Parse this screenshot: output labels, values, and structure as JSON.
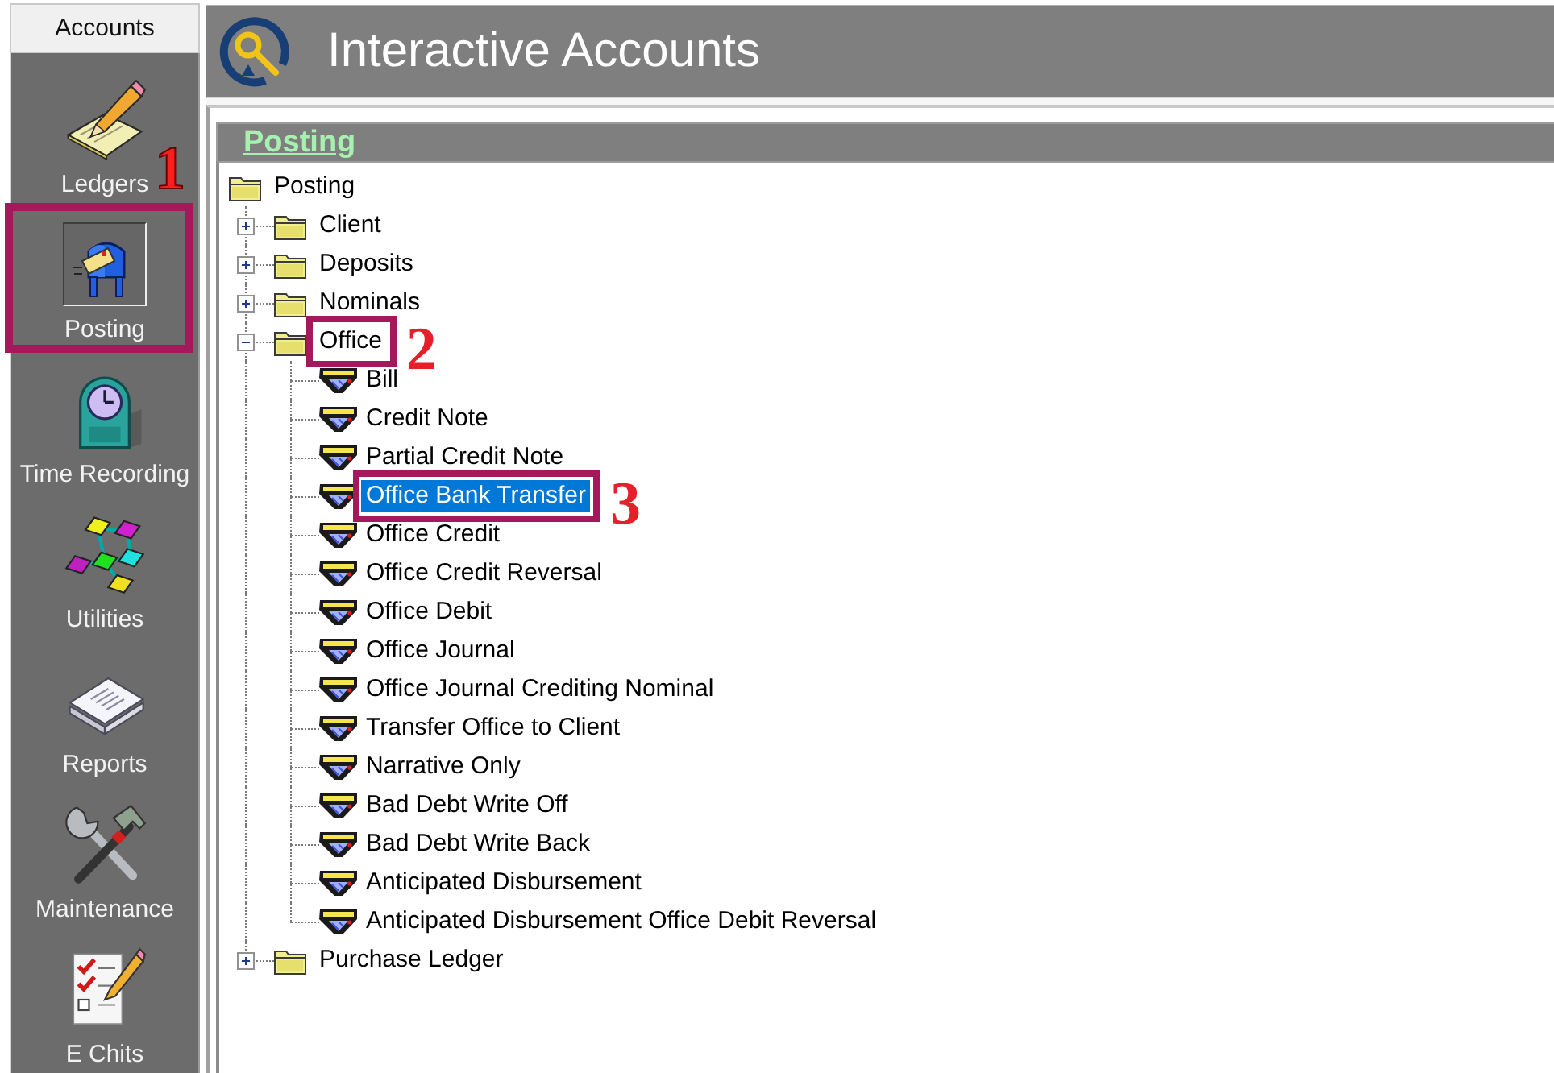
{
  "sidebar": {
    "header": "Accounts",
    "items": [
      {
        "label": "Ledgers",
        "kind": "ledgers",
        "selected": false
      },
      {
        "label": "Posting",
        "kind": "posting",
        "selected": true,
        "callout": "1"
      },
      {
        "label": "Time Recording",
        "kind": "time",
        "selected": false
      },
      {
        "label": "Utilities",
        "kind": "utilities",
        "selected": false
      },
      {
        "label": "Reports",
        "kind": "reports",
        "selected": false
      },
      {
        "label": "Maintenance",
        "kind": "maintenance",
        "selected": false
      },
      {
        "label": "E Chits",
        "kind": "chits",
        "selected": false
      }
    ]
  },
  "header": {
    "title": "Interactive Accounts"
  },
  "panel": {
    "title": "Posting",
    "tree": {
      "label": "Posting",
      "kind": "folder",
      "selected": false,
      "children": [
        {
          "label": "Client",
          "kind": "folder",
          "expanded": false,
          "selected": false
        },
        {
          "label": "Deposits",
          "kind": "folder",
          "expanded": false,
          "selected": false
        },
        {
          "label": "Nominals",
          "kind": "folder",
          "expanded": false,
          "selected": false
        },
        {
          "label": "Office",
          "kind": "folder",
          "expanded": true,
          "selected": false,
          "callout": "2",
          "children": [
            {
              "label": "Bill",
              "kind": "form",
              "selected": false
            },
            {
              "label": "Credit Note",
              "kind": "form",
              "selected": false
            },
            {
              "label": "Partial Credit Note",
              "kind": "form",
              "selected": false
            },
            {
              "label": "Office Bank Transfer",
              "kind": "form",
              "selected": true,
              "callout": "3"
            },
            {
              "label": "Office Credit",
              "kind": "form",
              "selected": false
            },
            {
              "label": "Office Credit Reversal",
              "kind": "form",
              "selected": false
            },
            {
              "label": "Office Debit",
              "kind": "form",
              "selected": false
            },
            {
              "label": "Office Journal",
              "kind": "form",
              "selected": false
            },
            {
              "label": "Office Journal Crediting Nominal",
              "kind": "form",
              "selected": false
            },
            {
              "label": "Transfer Office to Client",
              "kind": "form",
              "selected": false
            },
            {
              "label": "Narrative Only",
              "kind": "form",
              "selected": false
            },
            {
              "label": "Bad Debt Write Off",
              "kind": "form",
              "selected": false
            },
            {
              "label": "Bad Debt Write Back",
              "kind": "form",
              "selected": false
            },
            {
              "label": "Anticipated Disbursement",
              "kind": "form",
              "selected": false
            },
            {
              "label": "Anticipated Disbursement Office Debit Reversal",
              "kind": "form",
              "selected": false
            }
          ]
        },
        {
          "label": "Purchase Ledger",
          "kind": "folder",
          "expanded": false,
          "selected": false
        }
      ]
    }
  }
}
